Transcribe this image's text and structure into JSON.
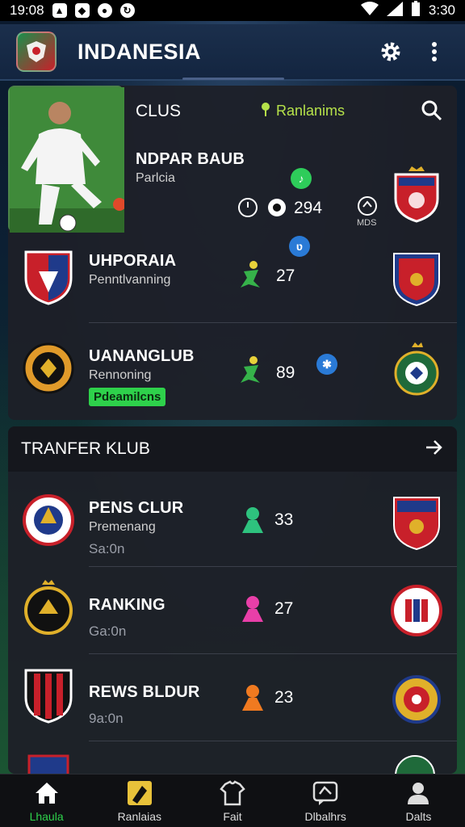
{
  "status_bar": {
    "time_left": "19:08",
    "time_right": "3:30"
  },
  "app_bar": {
    "title": "INDANESIA",
    "icons": [
      "app-logo-icon",
      "gear-icon",
      "more-vert-icon"
    ]
  },
  "top_panel": {
    "section_label": "CLUS",
    "filter_label": "Ranlanims",
    "featured": {
      "name": "NDPAR BAUB",
      "subtitle": "Parlcia",
      "stat": "294",
      "side_label": "MDS"
    },
    "clubs": [
      {
        "name": "UHPORAIA",
        "subtitle": "Penntlvanning",
        "stat": "27"
      },
      {
        "name": "UANANGLUB",
        "subtitle": "Rennoning",
        "stat": "89",
        "tag": "Pdeamilcns"
      }
    ]
  },
  "transfer": {
    "title": "TRANFER KLUB",
    "clubs": [
      {
        "name": "PENS CLUR",
        "subtitle": "Premenang",
        "season": "Sa:0n",
        "stat": "33",
        "icon_color": "#2ec27e"
      },
      {
        "name": "RANKING",
        "subtitle": "",
        "season": "Ga:0n",
        "stat": "27",
        "icon_color": "#e83fa8"
      },
      {
        "name": "REWS BLDUR",
        "subtitle": "",
        "season": "9a:0n",
        "stat": "23",
        "icon_color": "#f07a20"
      }
    ]
  },
  "bottom_nav": [
    {
      "label": "Lhaula",
      "icon": "home-icon",
      "active": true
    },
    {
      "label": "Ranlaias",
      "icon": "ranking-icon",
      "active": false
    },
    {
      "label": "Fait",
      "icon": "shirt-icon",
      "active": false
    },
    {
      "label": "Dlbalhrs",
      "icon": "chat-icon",
      "active": false
    },
    {
      "label": "Dalts",
      "icon": "profile-icon",
      "active": false
    }
  ],
  "colors": {
    "accent_green": "#2ed14b",
    "panel_bg": "#1e2028",
    "filter_green": "#b6e24a"
  }
}
